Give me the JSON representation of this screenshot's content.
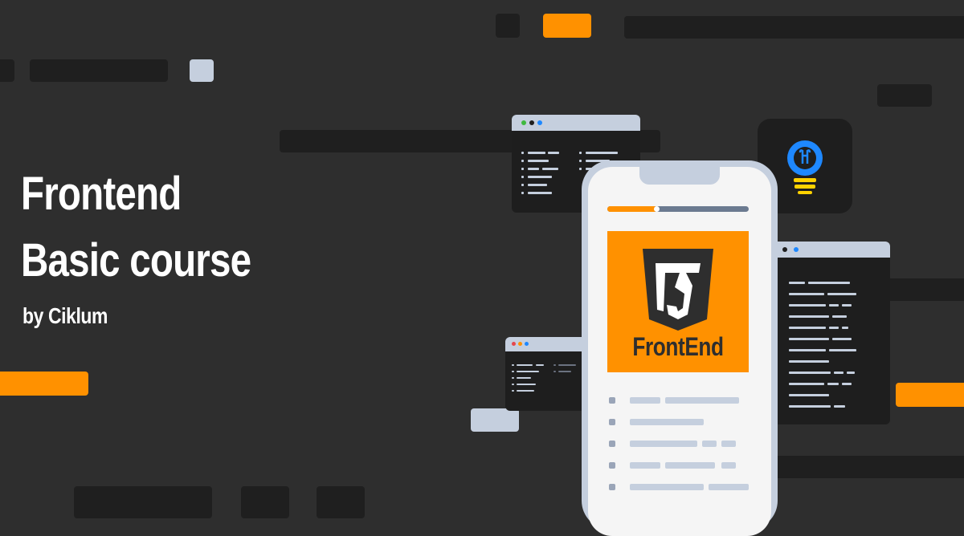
{
  "hero": {
    "title_line1": "Frontend",
    "title_line2": "Basic course",
    "byline": "by Ciklum"
  },
  "logo": {
    "label": "FrontEnd",
    "icon": "frontend-shield-icon"
  },
  "icons": {
    "idea": "lightbulb-icon"
  },
  "colors": {
    "background": "#2e2e2e",
    "accent": "#ff9100",
    "block": "#1f1f1f",
    "light": "#c5cfde",
    "bulb_blue": "#1e88ff",
    "bulb_yellow": "#ffd200"
  }
}
